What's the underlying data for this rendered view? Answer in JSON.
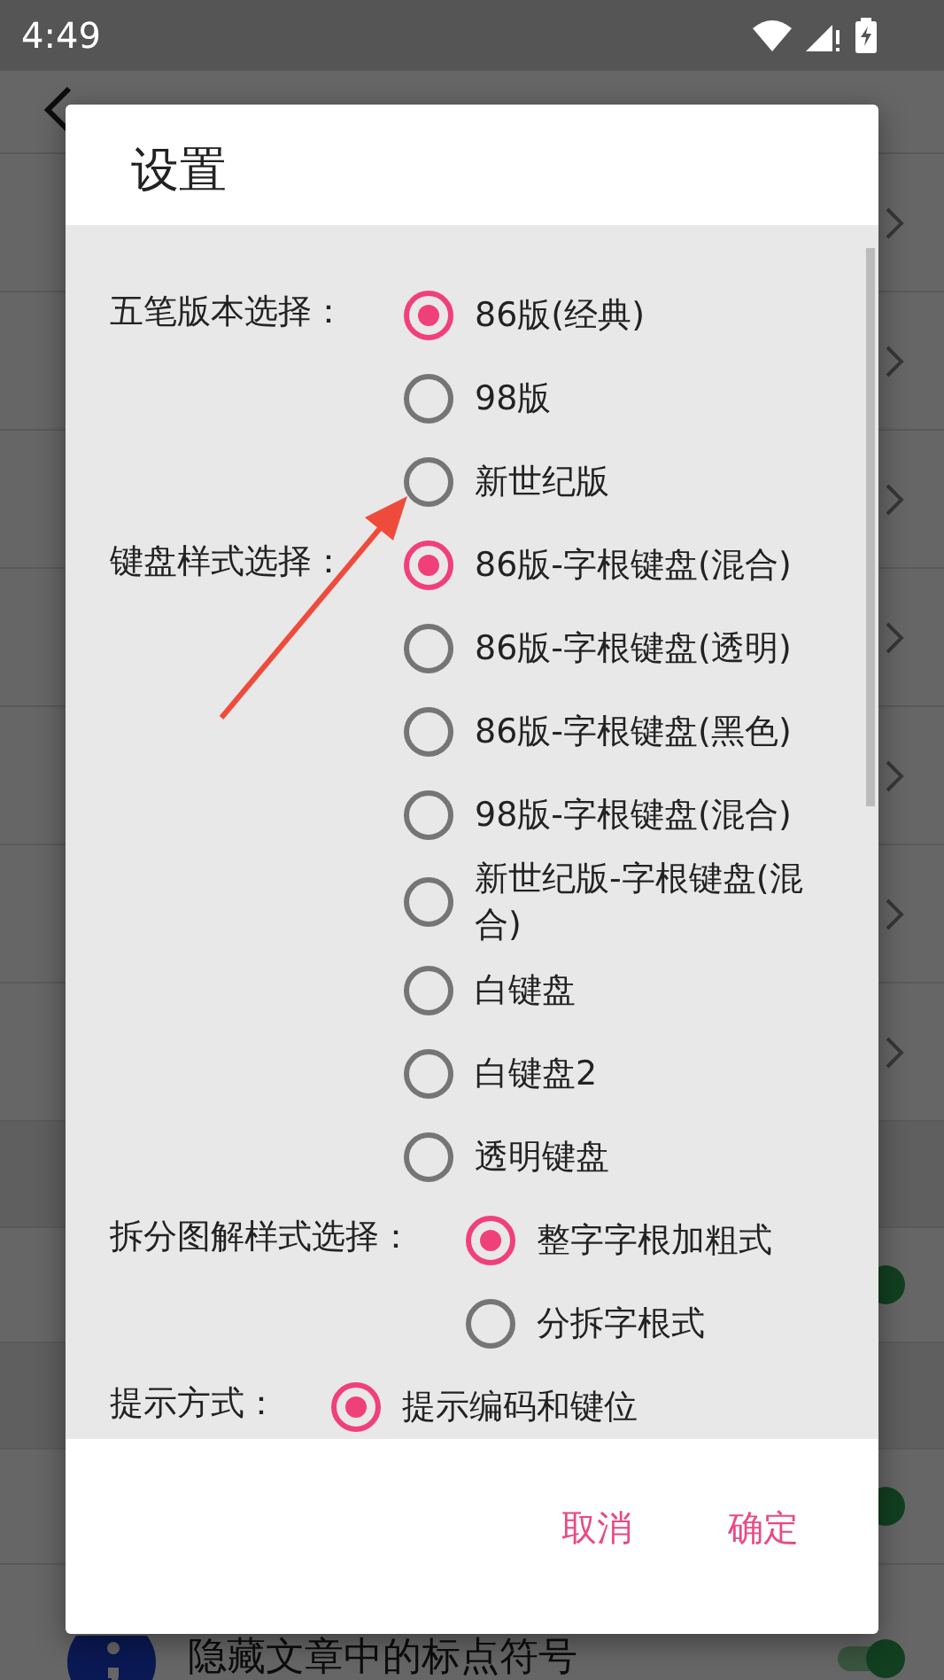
{
  "status_bar": {
    "time": "4:49"
  },
  "app": {
    "rows": [
      {
        "kind": "nav"
      },
      {
        "kind": "nav"
      },
      {
        "kind": "nav"
      },
      {
        "kind": "nav"
      },
      {
        "kind": "nav"
      },
      {
        "kind": "nav"
      },
      {
        "kind": "nav"
      },
      {
        "kind": "header"
      },
      {
        "kind": "toggle",
        "on": true
      },
      {
        "kind": "header"
      },
      {
        "kind": "toggle",
        "on": true
      },
      {
        "kind": "icon_toggle",
        "label": "隐藏文章中的标点符号",
        "on": true
      }
    ]
  },
  "dialog": {
    "title": "设置",
    "groups": [
      {
        "label": "五笔版本选择：",
        "options": [
          {
            "label": "86版(经典)",
            "selected": true
          },
          {
            "label": "98版",
            "selected": false
          },
          {
            "label": "新世纪版",
            "selected": false
          }
        ]
      },
      {
        "label": "键盘样式选择：",
        "options": [
          {
            "label": "86版-字根键盘(混合)",
            "selected": true
          },
          {
            "label": "86版-字根键盘(透明)",
            "selected": false
          },
          {
            "label": "86版-字根键盘(黑色)",
            "selected": false
          },
          {
            "label": "98版-字根键盘(混合)",
            "selected": false
          },
          {
            "label": "新世纪版-字根键盘(混合)",
            "selected": false
          },
          {
            "label": "白键盘",
            "selected": false
          },
          {
            "label": "白键盘2",
            "selected": false
          },
          {
            "label": "透明键盘",
            "selected": false
          }
        ]
      },
      {
        "label": "拆分图解样式选择：",
        "options": [
          {
            "label": "整字字根加粗式",
            "selected": true
          },
          {
            "label": "分拆字根式",
            "selected": false
          }
        ]
      },
      {
        "label": "提示方式：",
        "options": [
          {
            "label": "提示编码和键位",
            "selected": true
          }
        ]
      }
    ],
    "buttons": [
      "取消",
      "确定"
    ]
  }
}
